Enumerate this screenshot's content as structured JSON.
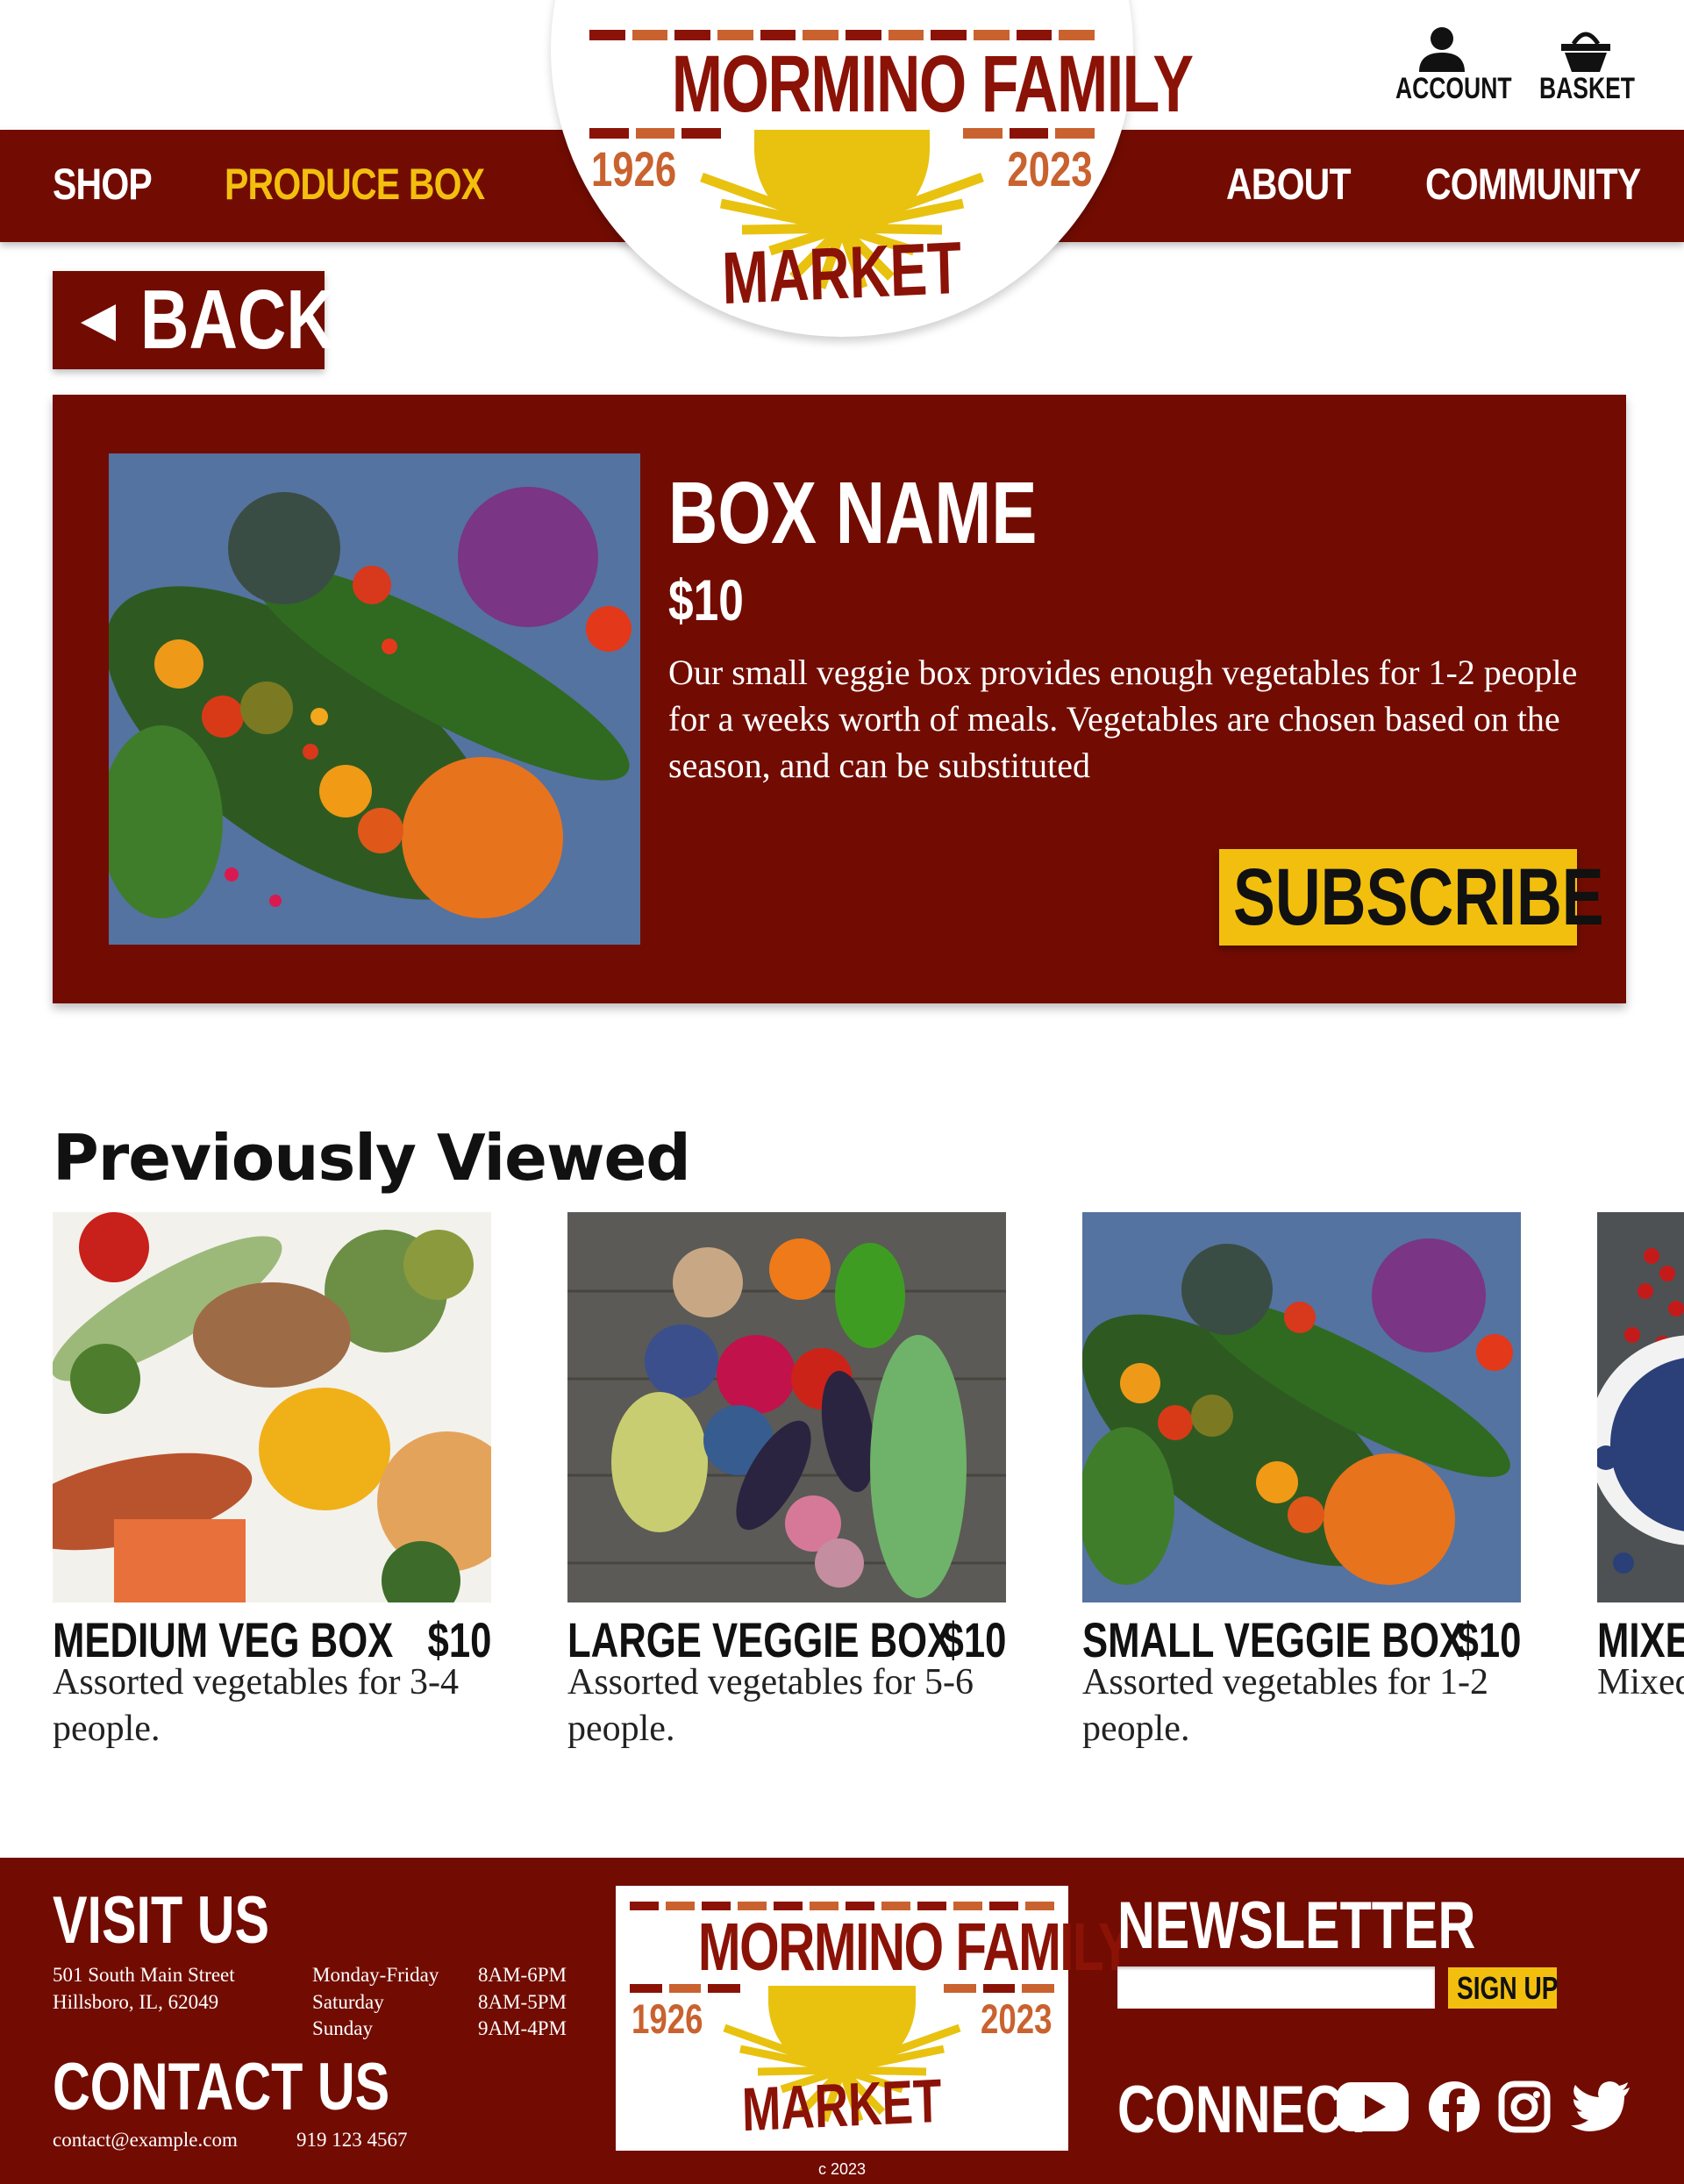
{
  "nav": {
    "shop": "SHOP",
    "produce_box": "PRODUCE BOX",
    "about": "ABOUT",
    "community": "COMMUNITY"
  },
  "logo": {
    "name": "MORMINO FAMILY",
    "year_start": "1926",
    "year_end": "2023",
    "market": "MARKET"
  },
  "header_icons": {
    "account": "ACCOUNT",
    "basket": "BASKET"
  },
  "back": {
    "label": "BACK"
  },
  "product": {
    "name": "BOX NAME",
    "price": "$10",
    "description": "Our small veggie box provides enough vegetables for 1-2 people for a weeks worth of meals. Vegetables are chosen based on the season, and can be substituted",
    "subscribe_label": "SUBSCRIBE"
  },
  "previously_viewed": {
    "title": "Previously Viewed",
    "items": [
      {
        "name": "MEDIUM VEG BOX",
        "price": "$10",
        "description": "Assorted vegetables for 3-4 people."
      },
      {
        "name": "LARGE VEGGIE BOX",
        "price": "$10",
        "description": "Assorted vegetables for 5-6 people."
      },
      {
        "name": "SMALL VEGGIE BOX",
        "price": "$10",
        "description": "Assorted vegetables for 1-2 people."
      },
      {
        "name": "MIXED",
        "price": "",
        "description": "Mixed people"
      }
    ]
  },
  "footer": {
    "visit_us": "VISIT US",
    "address_line1": "501 South Main Street",
    "address_line2": "Hillsboro, IL, 62049",
    "hours": [
      {
        "days": "Monday-Friday",
        "time": "8AM-6PM"
      },
      {
        "days": "Saturday",
        "time": "8AM-5PM"
      },
      {
        "days": "Sunday",
        "time": "9AM-4PM"
      }
    ],
    "contact_us": "CONTACT US",
    "email": "contact@example.com",
    "phone": "919 123 4567",
    "newsletter": "NEWSLETTER",
    "newsletter_placeholder": "",
    "signup_label": "SIGN UP",
    "connect": "CONNECT",
    "social_icons": [
      "youtube-icon",
      "facebook-icon",
      "instagram-icon",
      "twitter-icon"
    ],
    "copyright": "c 2023"
  },
  "colors": {
    "brand_red": "#720c02",
    "accent_yellow": "#f2bf0f",
    "logo_orange": "#c9622f"
  }
}
